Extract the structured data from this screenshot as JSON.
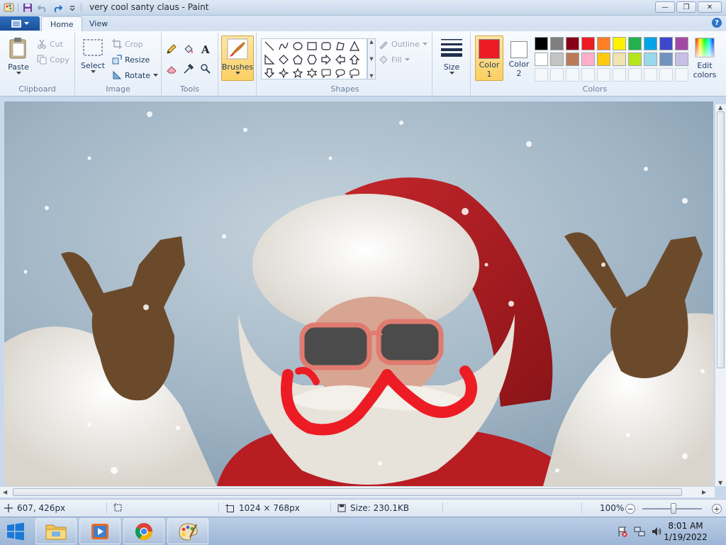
{
  "window": {
    "title": "very cool santy claus - Paint",
    "minimize": "—",
    "maximize": "❐",
    "close": "✕"
  },
  "tabs": {
    "home": "Home",
    "view": "View",
    "help": "?"
  },
  "ribbon": {
    "clipboard": {
      "label": "Clipboard",
      "paste": "Paste",
      "cut": "Cut",
      "copy": "Copy"
    },
    "image": {
      "label": "Image",
      "select": "Select",
      "crop": "Crop",
      "resize": "Resize",
      "rotate": "Rotate"
    },
    "tools": {
      "label": "Tools"
    },
    "brushes": {
      "label": "Brushes"
    },
    "shapes": {
      "label": "Shapes",
      "outline": "Outline",
      "fill": "Fill"
    },
    "size": {
      "label": "Size"
    },
    "colors": {
      "label": "Colors",
      "color1": "Color 1",
      "color1_line1": "Color",
      "color1_line2": "1",
      "color2_line1": "Color",
      "color2_line2": "2",
      "edit_line1": "Edit",
      "edit_line2": "colors",
      "color1_value": "#ed1c24",
      "color2_value": "#ffffff",
      "palette_row1": [
        "#000000",
        "#7f7f7f",
        "#880015",
        "#ed1c24",
        "#ff7f27",
        "#fff200",
        "#22b14c",
        "#00a2e8",
        "#3f48cc",
        "#a349a4"
      ],
      "palette_row2": [
        "#ffffff",
        "#c3c3c3",
        "#b97a57",
        "#ffaec9",
        "#ffc90e",
        "#efe4b0",
        "#b5e61d",
        "#99d9ea",
        "#7092be",
        "#c8bfe7"
      ]
    }
  },
  "status": {
    "cursor_pos": "607, 426px",
    "image_size": "1024 × 768px",
    "file_size": "Size: 230.1KB",
    "zoom": "100%",
    "zoom_level_percent": 100
  },
  "taskbar": {
    "time": "8:01 AM",
    "date": "1/19/2022"
  }
}
